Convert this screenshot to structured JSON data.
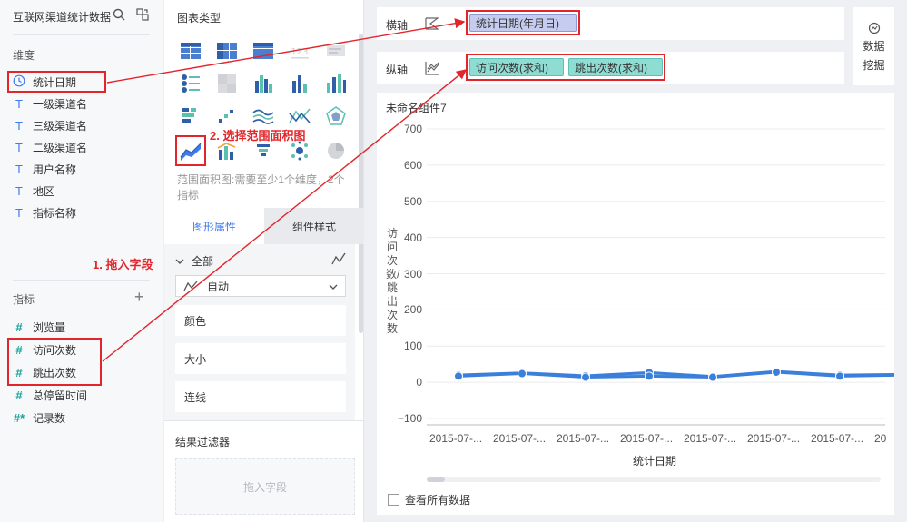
{
  "left": {
    "title": "互联网渠道统计数据",
    "dimension_label": "维度",
    "dimensions": [
      {
        "label": "统计日期",
        "icon": "clock-icon"
      },
      {
        "label": "一级渠道名",
        "icon": "text-type-icon"
      },
      {
        "label": "三级渠道名",
        "icon": "text-type-icon"
      },
      {
        "label": "二级渠道名",
        "icon": "text-type-icon"
      },
      {
        "label": "用户名称",
        "icon": "text-type-icon"
      },
      {
        "label": "地区",
        "icon": "text-type-icon"
      },
      {
        "label": "指标名称",
        "icon": "text-type-icon"
      }
    ],
    "measure_label": "指标",
    "measures": [
      {
        "label": "浏览量"
      },
      {
        "label": "访问次数"
      },
      {
        "label": "跳出次数"
      },
      {
        "label": "总停留时间"
      },
      {
        "label": "记录数"
      }
    ]
  },
  "middle": {
    "chart_type_label": "图表类型",
    "chart_type_hint": "范围面积图:需要至少1个维度，2个指标",
    "tabs": [
      "图形属性",
      "组件样式"
    ],
    "all_label": "全部",
    "auto_label": "自动",
    "props": [
      "颜色",
      "大小",
      "连线"
    ],
    "filter_title": "结果过滤器",
    "filter_placeholder": "拖入字段"
  },
  "axes": {
    "x_label": "横轴",
    "y_label": "纵轴",
    "x_field": "统计日期(年月日)",
    "y_fields": [
      "访问次数(求和)",
      "跳出次数(求和)"
    ]
  },
  "mining": {
    "line1": "数据",
    "line2": "挖掘"
  },
  "chart": {
    "title": "未命名组件7",
    "show_all_label": "查看所有数据"
  },
  "chart_data": {
    "type": "area",
    "title": "未命名组件7",
    "xlabel": "统计日期",
    "ylabel": "访问次数/跳出次数",
    "ylim": [
      -100,
      700
    ],
    "yticks": [
      "700",
      "600",
      "500",
      "400",
      "300",
      "200",
      "100",
      "0",
      "−100"
    ],
    "categories": [
      "2015-07-...",
      "2015-07-...",
      "2015-07-...",
      "2015-07-...",
      "2015-07-...",
      "2015-07-...",
      "2015-07-...",
      "20"
    ],
    "series": [
      {
        "values": [
          20,
          26,
          18,
          27,
          16,
          30,
          20,
          22
        ]
      },
      {
        "values": [
          17,
          24,
          14,
          17,
          14,
          28,
          17,
          20
        ]
      }
    ],
    "grid": true,
    "color": "#3a7fd9"
  },
  "annotations": {
    "step1": "1. 拖入字段",
    "step2": "2. 选择范围面积图"
  }
}
